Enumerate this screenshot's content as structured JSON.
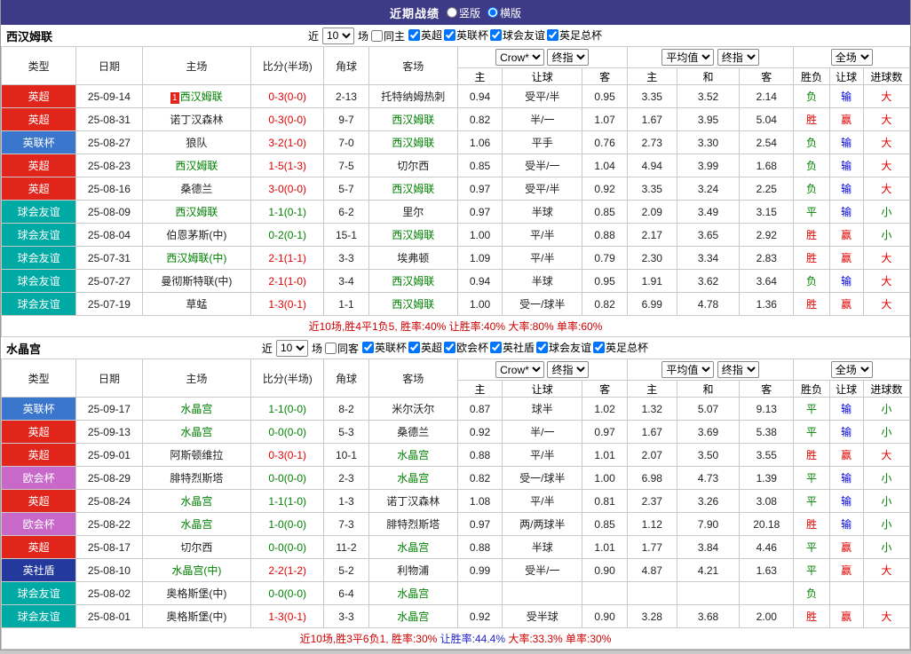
{
  "titlebar": {
    "title": "近期战绩",
    "options": [
      {
        "label": "竖版",
        "selected": false
      },
      {
        "label": "横版",
        "selected": true
      }
    ]
  },
  "table_headers": {
    "type": "类型",
    "date": "日期",
    "home": "主场",
    "score": "比分(半场)",
    "corner": "角球",
    "away": "客场",
    "odds_group1_selects": [
      "Crow*",
      "终指"
    ],
    "odds_group1_cols": [
      "主",
      "让球",
      "客"
    ],
    "odds_group2_selects": [
      "平均值",
      "终指"
    ],
    "odds_group2_cols": [
      "主",
      "和",
      "客"
    ],
    "result_select": "全场",
    "result_cols": [
      "胜负",
      "让球",
      "进球数"
    ]
  },
  "type_colors": {
    "英超": "#e1251b",
    "英联杯": "#3a76cc",
    "球会友谊": "#00aaa4",
    "欧会杯": "#c869ca",
    "英社盾": "#23399b"
  },
  "result_colors": {
    "胜": "#e00000",
    "平": "#008000",
    "负": "#008000",
    "赢": "#e00000",
    "输": "#0000dd",
    "大": "#e00000",
    "小": "#008000"
  },
  "score_colors": {
    "red": "#e00000",
    "green": "#008000"
  },
  "sections": [
    {
      "team": "西汉姆联",
      "filter": {
        "near": "近",
        "count": "10",
        "games": "场",
        "side": {
          "label": "同主",
          "checked": false
        },
        "leagues": [
          {
            "label": "英超",
            "checked": true
          },
          {
            "label": "英联杯",
            "checked": true
          },
          {
            "label": "球会友谊",
            "checked": true
          },
          {
            "label": "英足总杯",
            "checked": true
          }
        ]
      },
      "rows": [
        {
          "type": "英超",
          "date": "25-09-14",
          "home": "西汉姆联",
          "home_focal": true,
          "home_badge": "1",
          "score": "0-3(0-0)",
          "score_tone": "red",
          "corner": "2-13",
          "away": "托特纳姆热刺",
          "away_focal": false,
          "odds": [
            "0.94",
            "受平/半",
            "0.95"
          ],
          "avg": [
            "3.35",
            "3.52",
            "2.14"
          ],
          "results": [
            "负",
            "输",
            "大"
          ]
        },
        {
          "type": "英超",
          "date": "25-08-31",
          "home": "诺丁汉森林",
          "home_focal": false,
          "score": "0-3(0-0)",
          "score_tone": "red",
          "corner": "9-7",
          "away": "西汉姆联",
          "away_focal": true,
          "odds": [
            "0.82",
            "半/一",
            "1.07"
          ],
          "avg": [
            "1.67",
            "3.95",
            "5.04"
          ],
          "results": [
            "胜",
            "赢",
            "大"
          ]
        },
        {
          "type": "英联杯",
          "date": "25-08-27",
          "home": "狼队",
          "home_focal": false,
          "score": "3-2(1-0)",
          "score_tone": "red",
          "corner": "7-0",
          "away": "西汉姆联",
          "away_focal": true,
          "odds": [
            "1.06",
            "平手",
            "0.76"
          ],
          "avg": [
            "2.73",
            "3.30",
            "2.54"
          ],
          "results": [
            "负",
            "输",
            "大"
          ]
        },
        {
          "type": "英超",
          "date": "25-08-23",
          "home": "西汉姆联",
          "home_focal": true,
          "score": "1-5(1-3)",
          "score_tone": "red",
          "corner": "7-5",
          "away": "切尔西",
          "away_focal": false,
          "odds": [
            "0.85",
            "受半/一",
            "1.04"
          ],
          "avg": [
            "4.94",
            "3.99",
            "1.68"
          ],
          "results": [
            "负",
            "输",
            "大"
          ]
        },
        {
          "type": "英超",
          "date": "25-08-16",
          "home": "桑德兰",
          "home_focal": false,
          "score": "3-0(0-0)",
          "score_tone": "red",
          "corner": "5-7",
          "away": "西汉姆联",
          "away_focal": true,
          "odds": [
            "0.97",
            "受平/半",
            "0.92"
          ],
          "avg": [
            "3.35",
            "3.24",
            "2.25"
          ],
          "results": [
            "负",
            "输",
            "大"
          ]
        },
        {
          "type": "球会友谊",
          "date": "25-08-09",
          "home": "西汉姆联",
          "home_focal": true,
          "score": "1-1(0-1)",
          "score_tone": "green",
          "corner": "6-2",
          "away": "里尔",
          "away_focal": false,
          "odds": [
            "0.97",
            "半球",
            "0.85"
          ],
          "avg": [
            "2.09",
            "3.49",
            "3.15"
          ],
          "results": [
            "平",
            "输",
            "小"
          ]
        },
        {
          "type": "球会友谊",
          "date": "25-08-04",
          "home": "伯恩茅斯(中)",
          "home_focal": false,
          "score": "0-2(0-1)",
          "score_tone": "green",
          "corner": "15-1",
          "away": "西汉姆联",
          "away_focal": true,
          "odds": [
            "1.00",
            "平/半",
            "0.88"
          ],
          "avg": [
            "2.17",
            "3.65",
            "2.92"
          ],
          "results": [
            "胜",
            "赢",
            "小"
          ]
        },
        {
          "type": "球会友谊",
          "date": "25-07-31",
          "home": "西汉姆联(中)",
          "home_focal": true,
          "score": "2-1(1-1)",
          "score_tone": "red",
          "corner": "3-3",
          "away": "埃弗顿",
          "away_focal": false,
          "odds": [
            "1.09",
            "平/半",
            "0.79"
          ],
          "avg": [
            "2.30",
            "3.34",
            "2.83"
          ],
          "results": [
            "胜",
            "赢",
            "大"
          ]
        },
        {
          "type": "球会友谊",
          "date": "25-07-27",
          "home": "曼彻斯特联(中)",
          "home_focal": false,
          "score": "2-1(1-0)",
          "score_tone": "red",
          "corner": "3-4",
          "away": "西汉姆联",
          "away_focal": true,
          "odds": [
            "0.94",
            "半球",
            "0.95"
          ],
          "avg": [
            "1.91",
            "3.62",
            "3.64"
          ],
          "results": [
            "负",
            "输",
            "大"
          ]
        },
        {
          "type": "球会友谊",
          "date": "25-07-19",
          "home": "草蜢",
          "home_focal": false,
          "score": "1-3(0-1)",
          "score_tone": "red",
          "corner": "1-1",
          "away": "西汉姆联",
          "away_focal": true,
          "odds": [
            "1.00",
            "受一/球半",
            "0.82"
          ],
          "avg": [
            "6.99",
            "4.78",
            "1.36"
          ],
          "results": [
            "胜",
            "赢",
            "大"
          ]
        }
      ],
      "summary": [
        {
          "text": "近10场,胜4平1负5, 胜率:40% 让胜率:40% 大率:80% 单率:60%",
          "color": "#cc0000"
        }
      ]
    },
    {
      "team": "水晶宫",
      "filter": {
        "near": "近",
        "count": "10",
        "games": "场",
        "side": {
          "label": "同客",
          "checked": false
        },
        "leagues": [
          {
            "label": "英联杯",
            "checked": true
          },
          {
            "label": "英超",
            "checked": true
          },
          {
            "label": "欧会杯",
            "checked": true
          },
          {
            "label": "英社盾",
            "checked": true
          },
          {
            "label": "球会友谊",
            "checked": true
          },
          {
            "label": "英足总杯",
            "checked": true
          }
        ]
      },
      "rows": [
        {
          "type": "英联杯",
          "date": "25-09-17",
          "home": "水晶宫",
          "home_focal": true,
          "score": "1-1(0-0)",
          "score_tone": "green",
          "corner": "8-2",
          "away": "米尔沃尔",
          "away_focal": false,
          "odds": [
            "0.87",
            "球半",
            "1.02"
          ],
          "avg": [
            "1.32",
            "5.07",
            "9.13"
          ],
          "results": [
            "平",
            "输",
            "小"
          ]
        },
        {
          "type": "英超",
          "date": "25-09-13",
          "home": "水晶宫",
          "home_focal": true,
          "score": "0-0(0-0)",
          "score_tone": "green",
          "corner": "5-3",
          "away": "桑德兰",
          "away_focal": false,
          "odds": [
            "0.92",
            "半/一",
            "0.97"
          ],
          "avg": [
            "1.67",
            "3.69",
            "5.38"
          ],
          "results": [
            "平",
            "输",
            "小"
          ]
        },
        {
          "type": "英超",
          "date": "25-09-01",
          "home": "阿斯顿维拉",
          "home_focal": false,
          "score": "0-3(0-1)",
          "score_tone": "red",
          "corner": "10-1",
          "away": "水晶宫",
          "away_focal": true,
          "odds": [
            "0.88",
            "平/半",
            "1.01"
          ],
          "avg": [
            "2.07",
            "3.50",
            "3.55"
          ],
          "results": [
            "胜",
            "赢",
            "大"
          ]
        },
        {
          "type": "欧会杯",
          "date": "25-08-29",
          "home": "腓特烈斯塔",
          "home_focal": false,
          "score": "0-0(0-0)",
          "score_tone": "green",
          "corner": "2-3",
          "away": "水晶宫",
          "away_focal": true,
          "odds": [
            "0.82",
            "受一/球半",
            "1.00"
          ],
          "avg": [
            "6.98",
            "4.73",
            "1.39"
          ],
          "results": [
            "平",
            "输",
            "小"
          ]
        },
        {
          "type": "英超",
          "date": "25-08-24",
          "home": "水晶宫",
          "home_focal": true,
          "score": "1-1(1-0)",
          "score_tone": "green",
          "corner": "1-3",
          "away": "诺丁汉森林",
          "away_focal": false,
          "odds": [
            "1.08",
            "平/半",
            "0.81"
          ],
          "avg": [
            "2.37",
            "3.26",
            "3.08"
          ],
          "results": [
            "平",
            "输",
            "小"
          ]
        },
        {
          "type": "欧会杯",
          "date": "25-08-22",
          "home": "水晶宫",
          "home_focal": true,
          "score": "1-0(0-0)",
          "score_tone": "green",
          "corner": "7-3",
          "away": "腓特烈斯塔",
          "away_focal": false,
          "odds": [
            "0.97",
            "两/两球半",
            "0.85"
          ],
          "avg": [
            "1.12",
            "7.90",
            "20.18"
          ],
          "results": [
            "胜",
            "输",
            "小"
          ]
        },
        {
          "type": "英超",
          "date": "25-08-17",
          "home": "切尔西",
          "home_focal": false,
          "score": "0-0(0-0)",
          "score_tone": "green",
          "corner": "11-2",
          "away": "水晶宫",
          "away_focal": true,
          "odds": [
            "0.88",
            "半球",
            "1.01"
          ],
          "avg": [
            "1.77",
            "3.84",
            "4.46"
          ],
          "results": [
            "平",
            "赢",
            "小"
          ]
        },
        {
          "type": "英社盾",
          "date": "25-08-10",
          "home": "水晶宫(中)",
          "home_focal": true,
          "score": "2-2(1-2)",
          "score_tone": "red",
          "corner": "5-2",
          "away": "利物浦",
          "away_focal": false,
          "odds": [
            "0.99",
            "受半/一",
            "0.90"
          ],
          "avg": [
            "4.87",
            "4.21",
            "1.63"
          ],
          "results": [
            "平",
            "赢",
            "大"
          ]
        },
        {
          "type": "球会友谊",
          "date": "25-08-02",
          "home": "奥格斯堡(中)",
          "home_focal": false,
          "score": "0-0(0-0)",
          "score_tone": "green",
          "corner": "6-4",
          "away": "水晶宫",
          "away_focal": true,
          "odds": [
            "",
            "",
            ""
          ],
          "avg": [
            "",
            "",
            ""
          ],
          "results": [
            "负",
            "",
            ""
          ]
        },
        {
          "type": "球会友谊",
          "date": "25-08-01",
          "home": "奥格斯堡(中)",
          "home_focal": false,
          "score": "1-3(0-1)",
          "score_tone": "red",
          "corner": "3-3",
          "away": "水晶宫",
          "away_focal": true,
          "odds": [
            "0.92",
            "受半球",
            "0.90"
          ],
          "avg": [
            "3.28",
            "3.68",
            "2.00"
          ],
          "results": [
            "胜",
            "赢",
            "大"
          ]
        }
      ],
      "summary": [
        {
          "text": "近10场,胜3平6负1, 胜率:30% ",
          "color": "#cc0000"
        },
        {
          "text": "让胜率:44.4%",
          "color": "#2222cc"
        },
        {
          "text": " 大率:33.3% 单率:30%",
          "color": "#cc0000"
        }
      ]
    }
  ]
}
